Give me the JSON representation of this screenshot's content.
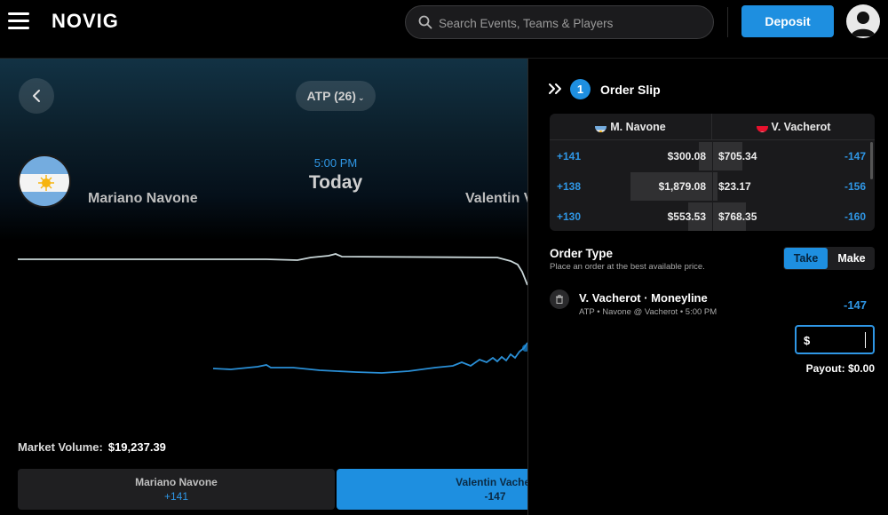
{
  "header": {
    "logo": "NOVIG",
    "search_placeholder": "Search Events, Teams & Players",
    "deposit_label": "Deposit"
  },
  "event": {
    "league_label": "ATP (26)",
    "time": "5:00 PM",
    "day": "Today",
    "player_left": "Mariano Navone",
    "player_right": "Valentin V",
    "market_volume_label": "Market Volume:",
    "market_volume_value": "$19,237.39",
    "buttons": [
      {
        "name": "Mariano Navone",
        "odds": "+141"
      },
      {
        "name": "Valentin Vacher",
        "odds": "-147"
      }
    ]
  },
  "order_slip": {
    "count": "1",
    "title": "Order Slip",
    "book": {
      "left_player": "M. Navone",
      "right_player": "V. Vacherot",
      "rows": [
        {
          "left_odds": "+141",
          "left_amount": "$300.08",
          "left_depth": 0.08,
          "right_amount": "$705.34",
          "right_depth": 0.18,
          "right_odds": "-147"
        },
        {
          "left_odds": "+138",
          "left_amount": "$1,879.08",
          "left_depth": 0.5,
          "right_amount": "$23.17",
          "right_depth": 0.03,
          "right_odds": "-156"
        },
        {
          "left_odds": "+130",
          "left_amount": "$553.53",
          "left_depth": 0.15,
          "right_amount": "$768.35",
          "right_depth": 0.2,
          "right_odds": "-160"
        }
      ]
    },
    "order_type_title": "Order Type",
    "order_type_sub": "Place an order at the best available price.",
    "take_label": "Take",
    "make_label": "Make",
    "selection_title": "V. Vacherot · Moneyline",
    "selection_meta": "ATP • Navone @ Vacherot • 5:00 PM",
    "selection_odds": "-147",
    "amount_currency": "$",
    "amount_value": "",
    "payout": "Payout: $0.00"
  },
  "colors": {
    "accent": "#1e8fe0",
    "odds_blue": "#2f97e6",
    "line_navone": "#c9d6d8",
    "line_vacherot": "#2a8fd6"
  }
}
